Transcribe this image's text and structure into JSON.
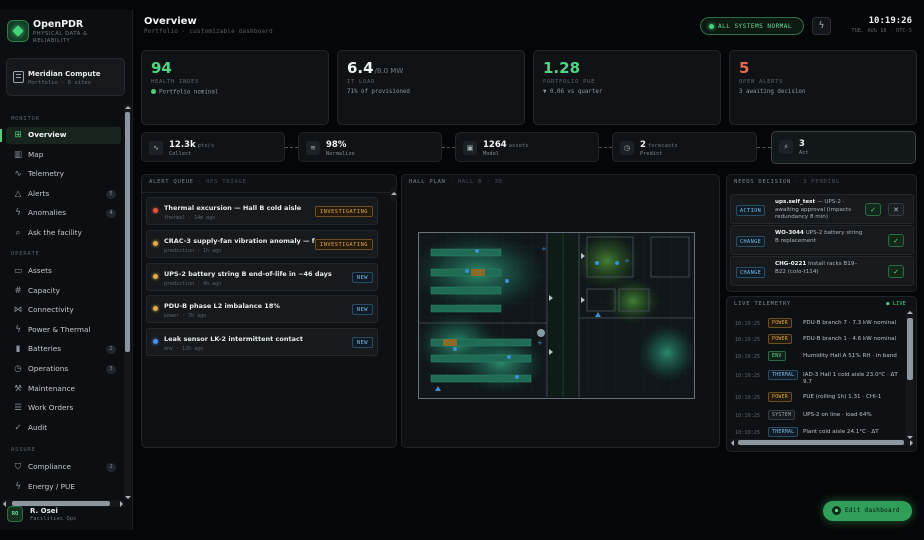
{
  "app": {
    "name": "OpenPDR",
    "tagline": "PHYSICAL DATA & RELIABILITY"
  },
  "org": {
    "name": "Meridian Compute",
    "sub": "Portfolio · 6 sites"
  },
  "sidebar": {
    "sections": [
      {
        "title": "Monitor",
        "items": [
          {
            "label": "Overview",
            "icon": "grid-icon",
            "active": true
          },
          {
            "label": "Map",
            "icon": "map-icon"
          },
          {
            "label": "Telemetry",
            "icon": "pulse-icon"
          },
          {
            "label": "Alerts",
            "icon": "warning-icon",
            "badge": "5"
          },
          {
            "label": "Anomalies",
            "icon": "zap-icon",
            "badge": "4"
          },
          {
            "label": "Ask the facility",
            "icon": "search-icon"
          }
        ]
      },
      {
        "title": "Operate",
        "items": [
          {
            "label": "Assets",
            "icon": "monitor-icon"
          },
          {
            "label": "Capacity",
            "icon": "hash-icon"
          },
          {
            "label": "Connectivity",
            "icon": "network-icon"
          },
          {
            "label": "Power & Thermal",
            "icon": "bolt-icon"
          },
          {
            "label": "Batteries",
            "icon": "battery-icon",
            "badge": "2"
          },
          {
            "label": "Operations",
            "icon": "clock-icon",
            "badge": "3"
          },
          {
            "label": "Maintenance",
            "icon": "wrench-icon"
          },
          {
            "label": "Work Orders",
            "icon": "list-icon"
          },
          {
            "label": "Audit",
            "icon": "check-icon"
          }
        ]
      },
      {
        "title": "Assure",
        "items": [
          {
            "label": "Compliance",
            "icon": "shield-icon",
            "badge": "2"
          },
          {
            "label": "Energy / PUE",
            "icon": "bolt-icon"
          }
        ]
      }
    ]
  },
  "user": {
    "initials": "RO",
    "name": "R. Osei",
    "role": "Facilities Ops"
  },
  "header": {
    "title": "Overview",
    "subtitle": "Portfolio · customizable dashboard",
    "status": "ALL SYSTEMS NORMAL",
    "time": "10:19:26",
    "date": "TUE, AUG 18 · UTC-5"
  },
  "kpis": [
    {
      "value": "94",
      "unit": "",
      "label": "Health index",
      "foot": "Portfolio nominal",
      "color": "#4fd684",
      "dot": true
    },
    {
      "value": "6.4",
      "unit": "/8.0 MW",
      "label": "IT load",
      "foot": "71% of provisioned",
      "color": "#eef3f5"
    },
    {
      "value": "1.28",
      "unit": "",
      "label": "Portfolio PUE",
      "foot": "▼ 0.06 vs quarter",
      "color": "#4fd684"
    },
    {
      "value": "5",
      "unit": "",
      "label": "Open alerts",
      "foot": "3 awaiting decision",
      "color": "#e86a4f"
    }
  ],
  "pipeline": [
    {
      "value": "12.3k",
      "unit": "pts/s",
      "name": "Collect",
      "icon": "pulse-icon",
      "glyph": "∿"
    },
    {
      "value": "98%",
      "unit": "",
      "name": "Normalize",
      "icon": "layers-icon",
      "glyph": "≋"
    },
    {
      "value": "1264",
      "unit": "assets",
      "name": "Model",
      "icon": "cube-icon",
      "glyph": "▣"
    },
    {
      "value": "2",
      "unit": "forecasts",
      "name": "Predict",
      "icon": "clock-icon",
      "glyph": "◷"
    },
    {
      "value": "3",
      "unit": "",
      "name": "Act",
      "icon": "bolt-icon",
      "glyph": "⚡"
    }
  ],
  "alerts_panel": {
    "title": "Alert queue",
    "title_dim": "· ops triage",
    "items": [
      {
        "title": "Thermal excursion — Hall B cold aisle",
        "meta": "thermal · 14m ago",
        "tag": "INVESTIGATING",
        "sev": "#e5533d"
      },
      {
        "title": "CRAC-3 supply-fan vibration anomaly — f…",
        "meta": "prediction · 1h ago",
        "tag": "INVESTIGATING",
        "sev": "#e0a84a"
      },
      {
        "title": "UPS-2 battery string B end-of-life in ~46 days",
        "meta": "prediction · 4h ago",
        "tag": "NEW",
        "sev": "#e0a84a"
      },
      {
        "title": "PDU-B phase L2 imbalance 18%",
        "meta": "power · 7h ago",
        "tag": "NEW",
        "sev": "#e0a84a"
      },
      {
        "title": "Leak sensor LK-2 intermittent contact",
        "meta": "env · 12h ago",
        "tag": "NEW",
        "sev": "#4f8fe0"
      }
    ]
  },
  "hall_plan": {
    "title": "Hall plan",
    "title_dim": "· Hall B · 3D"
  },
  "decisions": {
    "title": "Needs decision",
    "title_dim": "· 3 pending",
    "items": [
      {
        "tag": "ACTION",
        "id": "ups.self_test",
        "text": " — UPS-2 · awaiting approval (impacts redundancy 8 min)",
        "reject": true
      },
      {
        "tag": "CHANGE",
        "id": "WO-3044",
        "text": " UPS-2 battery string B replacement"
      },
      {
        "tag": "CHANGE",
        "id": "CHG-0221",
        "text": " Install racks B19–B22 (colo-t114)"
      }
    ]
  },
  "telemetry": {
    "title": "Live telemetry",
    "status": "● LIVE",
    "rows": [
      {
        "time": "10:19:25",
        "chip": "POWER",
        "kind": "power",
        "text": "PDU-B branch 7 · 7.3 kW nominal"
      },
      {
        "time": "10:19:25",
        "chip": "POWER",
        "kind": "power",
        "text": "PDU-B branch 1 · 4.6 kW nominal"
      },
      {
        "time": "10:19:25",
        "chip": "ENV",
        "kind": "env",
        "text": "Humidity Hall A 51% RH · in band"
      },
      {
        "time": "10:19:25",
        "chip": "THERMAL",
        "kind": "thermal",
        "text": "IAD-3 Hall 1 cold aisle 23.0°C · ΔT 9.7"
      },
      {
        "time": "10:19:25",
        "chip": "POWER",
        "kind": "power",
        "text": "PUE (rolling 1h) 1.31 · CHI-1"
      },
      {
        "time": "10:19:25",
        "chip": "SYSTEM",
        "kind": "system",
        "text": "UPS-2 on line · load 64%"
      },
      {
        "time": "10:19:25",
        "chip": "THERMAL",
        "kind": "thermal",
        "text": "Plant cold aisle 24.1°C · ΔT"
      }
    ]
  },
  "actions": {
    "edit_dashboard": "Edit dashboard"
  },
  "colors": {
    "accent": "#48d27c",
    "warning": "#e0a84a",
    "danger": "#e5533d",
    "info": "#7dbde6"
  }
}
